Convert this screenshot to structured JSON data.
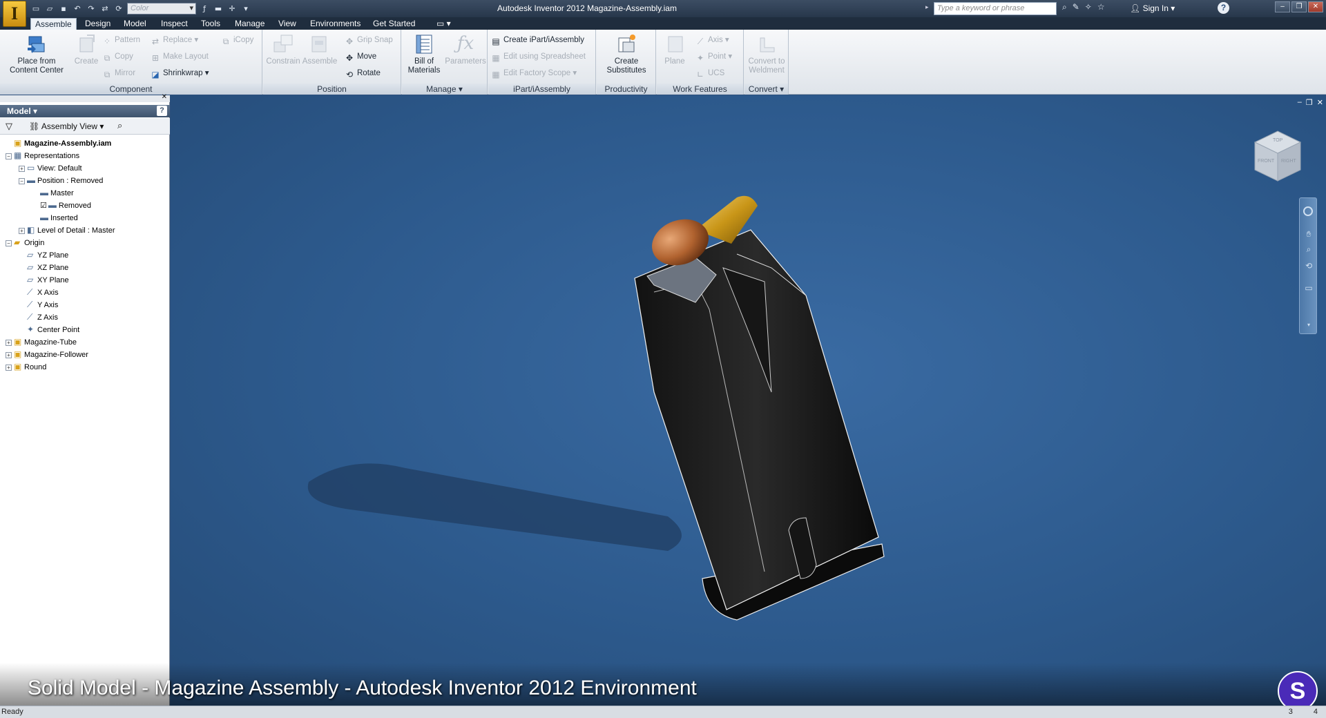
{
  "app": {
    "logo_letter": "I",
    "title": "Autodesk Inventor 2012   Magazine-Assembly.iam"
  },
  "qat": {
    "color_combo": "Color",
    "icons": [
      "new-icon",
      "open-icon",
      "save-icon",
      "undo-icon",
      "redo-icon"
    ]
  },
  "help_search": {
    "placeholder": "Type a keyword or phrase",
    "sign_in": "Sign In"
  },
  "tabs": [
    {
      "label": "Assemble",
      "active": true
    },
    {
      "label": "Design"
    },
    {
      "label": "Model"
    },
    {
      "label": "Inspect"
    },
    {
      "label": "Tools"
    },
    {
      "label": "Manage"
    },
    {
      "label": "View"
    },
    {
      "label": "Environments"
    },
    {
      "label": "Get Started"
    }
  ],
  "ribbon": {
    "component": {
      "title": "Component",
      "place_line1": "Place from",
      "place_line2": "Content Center",
      "create": "Create",
      "pattern": "Pattern",
      "copy": "Copy",
      "mirror": "Mirror",
      "replace": "Replace",
      "make_layout": "Make Layout",
      "shrinkwrap": "Shrinkwrap",
      "icopy": "iCopy"
    },
    "position": {
      "title": "Position",
      "constrain": "Constrain",
      "assemble": "Assemble",
      "grip_snap": "Grip Snap",
      "move": "Move",
      "rotate": "Rotate"
    },
    "manage": {
      "title": "Manage",
      "bom_line1": "Bill of",
      "bom_line2": "Materials",
      "parameters": "Parameters"
    },
    "ipart": {
      "title": "iPart/iAssembly",
      "create": "Create iPart/iAssembly",
      "edit_spreadsheet": "Edit using Spreadsheet",
      "edit_factory": "Edit Factory Scope"
    },
    "productivity": {
      "title": "Productivity",
      "subs_line1": "Create",
      "subs_line2": "Substitutes"
    },
    "work_features": {
      "title": "Work Features",
      "plane": "Plane",
      "axis": "Axis",
      "point": "Point",
      "ucs": "UCS"
    },
    "convert": {
      "title": "Convert",
      "weld_line1": "Convert to",
      "weld_line2": "Weldment"
    }
  },
  "browser": {
    "title": "Model",
    "view_combo": "Assembly View",
    "tree": [
      {
        "label": "Magazine-Assembly.iam",
        "level": 0,
        "bold": true,
        "icon": "assembly-icon"
      },
      {
        "label": "Representations",
        "level": 0,
        "expander": "−",
        "icon": "representations-icon"
      },
      {
        "label": "View: Default",
        "level": 1,
        "expander": "+",
        "icon": "view-rep-icon"
      },
      {
        "label": "Position : Removed",
        "level": 1,
        "expander": "−",
        "icon": "position-rep-icon"
      },
      {
        "label": "Master",
        "level": 2,
        "icon": "position-icon"
      },
      {
        "label": "Removed",
        "level": 2,
        "icon": "position-icon",
        "checked": true
      },
      {
        "label": "Inserted",
        "level": 2,
        "icon": "position-icon"
      },
      {
        "label": "Level of Detail : Master",
        "level": 1,
        "expander": "+",
        "icon": "lod-icon"
      },
      {
        "label": "Origin",
        "level": 0,
        "expander": "−",
        "icon": "folder-icon"
      },
      {
        "label": "YZ Plane",
        "level": 1,
        "icon": "plane-icon"
      },
      {
        "label": "XZ Plane",
        "level": 1,
        "icon": "plane-icon"
      },
      {
        "label": "XY Plane",
        "level": 1,
        "icon": "plane-icon"
      },
      {
        "label": "X Axis",
        "level": 1,
        "icon": "axis-icon"
      },
      {
        "label": "Y Axis",
        "level": 1,
        "icon": "axis-icon"
      },
      {
        "label": "Z Axis",
        "level": 1,
        "icon": "axis-icon"
      },
      {
        "label": "Center Point",
        "level": 1,
        "icon": "point-icon"
      },
      {
        "label": "Magazine-Tube",
        "level": 0,
        "expander": "+",
        "icon": "part-icon"
      },
      {
        "label": "Magazine-Follower",
        "level": 0,
        "expander": "+",
        "icon": "part-icon"
      },
      {
        "label": "Round",
        "level": 0,
        "expander": "+",
        "icon": "part-icon"
      }
    ]
  },
  "viewcube": {
    "top": "TOP",
    "front": "FRONT",
    "right": "RIGHT"
  },
  "caption": "Solid Model - Magazine Assembly - Autodesk Inventor 2012 Environment",
  "status": {
    "text": "Ready",
    "right1": "3",
    "right2": "4"
  },
  "colors": {
    "viewport": "#2d5a8d",
    "accent": "#f6c940",
    "badge": "#4a2ab8"
  }
}
